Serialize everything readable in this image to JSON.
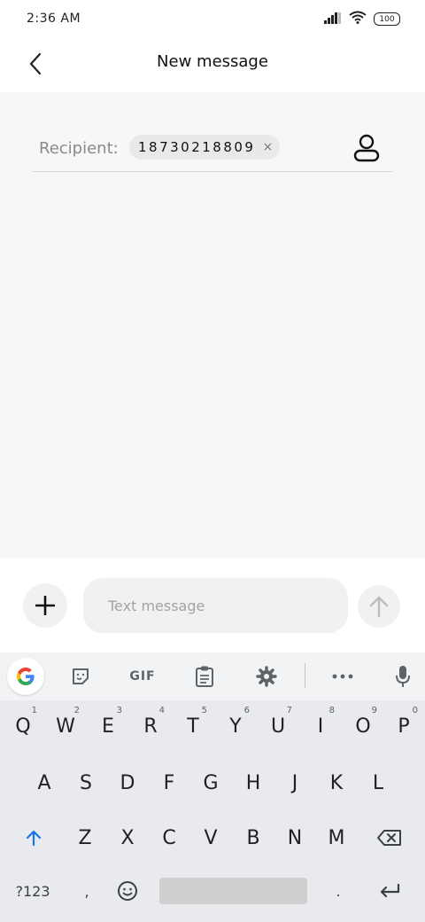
{
  "status_bar": {
    "time": "2:36 AM",
    "battery": "100",
    "icons": [
      "signal-icon",
      "wifi-icon",
      "battery-icon"
    ]
  },
  "header": {
    "title": "New message",
    "back_icon": "chevron-left-icon"
  },
  "recipient": {
    "label": "Recipient:",
    "chip_value": "18730218809",
    "chip_close": "×",
    "contact_icon": "person-icon"
  },
  "compose": {
    "placeholder": "Text message",
    "attach_icon": "plus-icon",
    "send_icon": "arrow-up-icon"
  },
  "keyboard": {
    "toolbar": {
      "gif_label": "GIF",
      "icons": [
        "google-g-icon",
        "sticker-icon",
        "gif-icon",
        "clipboard-icon",
        "gear-icon",
        "more-icon",
        "microphone-icon"
      ]
    },
    "row1": [
      {
        "k": "Q",
        "h": "1"
      },
      {
        "k": "W",
        "h": "2"
      },
      {
        "k": "E",
        "h": "3"
      },
      {
        "k": "R",
        "h": "4"
      },
      {
        "k": "T",
        "h": "5"
      },
      {
        "k": "Y",
        "h": "6"
      },
      {
        "k": "U",
        "h": "7"
      },
      {
        "k": "I",
        "h": "8"
      },
      {
        "k": "O",
        "h": "9"
      },
      {
        "k": "P",
        "h": "0"
      }
    ],
    "row2": [
      "A",
      "S",
      "D",
      "F",
      "G",
      "H",
      "J",
      "K",
      "L"
    ],
    "row3": [
      "Z",
      "X",
      "C",
      "V",
      "B",
      "N",
      "M"
    ],
    "row4": {
      "symbols_label": "?123",
      "comma": ",",
      "period": "."
    },
    "colors": {
      "shift_accent": "#1a73e8",
      "key_text": "#202124",
      "icon_gray": "#5f6368"
    }
  }
}
